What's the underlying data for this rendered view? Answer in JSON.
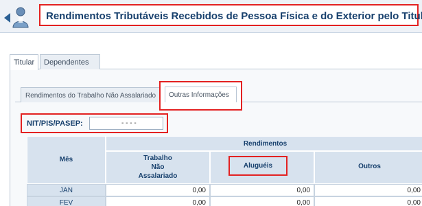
{
  "header": {
    "title": "Rendimentos Tributáveis Recebidos de Pessoa Física e do Exterior pelo Titular",
    "back_icon": "back-arrow-icon",
    "person_icon": "person-icon"
  },
  "outer_tabs": [
    {
      "label": "Titular",
      "active": true
    },
    {
      "label": "Dependentes",
      "active": false
    }
  ],
  "inner_tabs": [
    {
      "label": "Rendimentos do Trabalho Não Assalariado",
      "active": false
    },
    {
      "label": "Outras Informações",
      "active": true
    }
  ],
  "nit": {
    "label": "NIT/PIS/PASEP:",
    "value": "- - - -"
  },
  "table": {
    "group_header": "Rendimentos",
    "columns": {
      "mes": "Mês",
      "trabalho_lines": [
        "Trabalho",
        "Não",
        "Assalariado"
      ],
      "alugueis": "Aluguéis",
      "outros": "Outros"
    },
    "rows": [
      {
        "mes": "JAN",
        "trabalho": "0,00",
        "alugueis": "0,00",
        "outros": "0,00"
      },
      {
        "mes": "FEV",
        "trabalho": "0,00",
        "alugueis": "0,00",
        "outros": "0,00"
      }
    ]
  },
  "colors": {
    "highlight": "#e32121",
    "header_text": "#17406d",
    "table_header_bg": "#d7e2ee"
  }
}
